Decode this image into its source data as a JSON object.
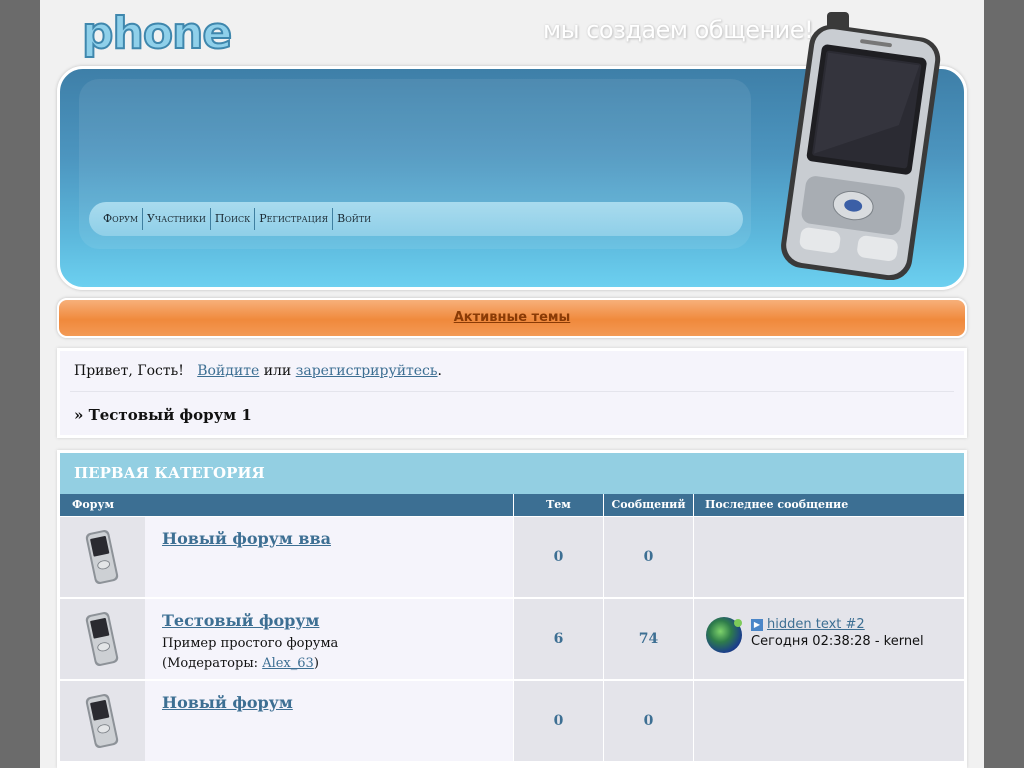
{
  "header": {
    "logo": "phone",
    "slogan": "мы создаем общение!"
  },
  "nav": {
    "items": [
      "Форум",
      "Участники",
      "Поиск",
      "Регистрация",
      "Войти"
    ]
  },
  "active_topics": {
    "label": "Активные темы"
  },
  "welcome": {
    "greeting": "Привет, Гость!",
    "login_link": "Войдите",
    "or": "или",
    "register_link": "зарегистрируйтесь",
    "period": ".",
    "breadcrumb": "» Тестовый форум 1"
  },
  "category": {
    "title": "ПЕРВАЯ КАТЕГОРИЯ",
    "columns": [
      "Форум",
      "Тем",
      "Сообщений",
      "Последнее сообщение"
    ],
    "forums": [
      {
        "name": "Новый форум вва",
        "topics": "0",
        "posts": "0"
      },
      {
        "name": "Тестовый форум",
        "description": "Пример простого форума",
        "moderators_prefix": "(Модераторы: ",
        "moderator": "Alex_63",
        "moderators_suffix": ")",
        "topics": "6",
        "posts": "74",
        "last_post": {
          "title": "hidden text #2",
          "time": "Сегодня 02:38:28 - kernel"
        }
      },
      {
        "name": "Новый форум",
        "topics": "0",
        "posts": "0"
      }
    ]
  },
  "colors": {
    "page_bg": "#6b6b6b",
    "accent_blue": "#3c6f93",
    "category_header": "#93cfe2",
    "active_bar": "#f0893c"
  }
}
